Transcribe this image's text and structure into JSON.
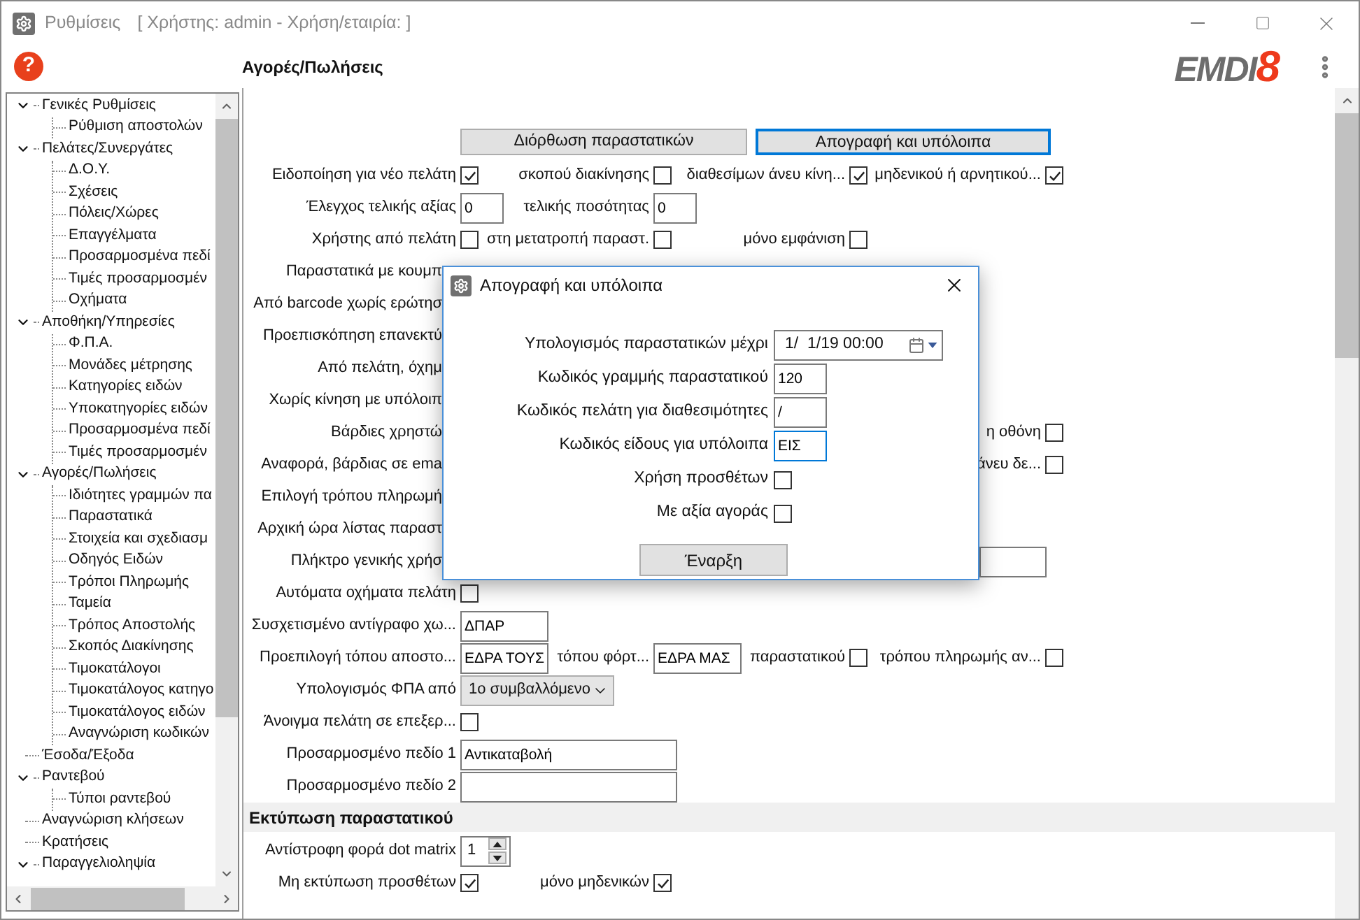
{
  "window": {
    "title": "Ρυθμίσεις",
    "context": "[ Χρήστης: admin - Χρήση/εταιρία: ]"
  },
  "header": {
    "help": "?",
    "title": "Αγορές/Πωλήσεις",
    "logo_text": "EMDI",
    "logo_mark": "8"
  },
  "sidebar": {
    "items": [
      {
        "label": "Γενικές Ρυθμίσεις",
        "expanded": true,
        "children": [
          {
            "label": "Ρύθμιση αποστολών"
          }
        ]
      },
      {
        "label": "Πελάτες/Συνεργάτες",
        "expanded": true,
        "children": [
          {
            "label": "Δ.Ο.Υ."
          },
          {
            "label": "Σχέσεις"
          },
          {
            "label": "Πόλεις/Χώρες"
          },
          {
            "label": "Επαγγέλματα"
          },
          {
            "label": "Προσαρμοσμένα πεδί"
          },
          {
            "label": "Τιμές προσαρμοσμέν"
          },
          {
            "label": "Οχήματα"
          }
        ]
      },
      {
        "label": "Αποθήκη/Υπηρεσίες",
        "expanded": true,
        "children": [
          {
            "label": "Φ.Π.Α."
          },
          {
            "label": "Μονάδες μέτρησης"
          },
          {
            "label": "Κατηγορίες ειδών"
          },
          {
            "label": "Υποκατηγορίες ειδών"
          },
          {
            "label": "Προσαρμοσμένα πεδί"
          },
          {
            "label": "Τιμές προσαρμοσμέν"
          }
        ]
      },
      {
        "label": "Αγορές/Πωλήσεις",
        "expanded": true,
        "children": [
          {
            "label": "Ιδιότητες γραμμών πα"
          },
          {
            "label": "Παραστατικά"
          },
          {
            "label": "Στοιχεία και σχεδιασμ"
          },
          {
            "label": "Οδηγός Ειδών"
          },
          {
            "label": "Τρόποι Πληρωμής"
          },
          {
            "label": "Ταμεία"
          },
          {
            "label": "Τρόπος Αποστολής"
          },
          {
            "label": "Σκοπός Διακίνησης"
          },
          {
            "label": "Τιμοκατάλογοι"
          },
          {
            "label": "Τιμοκατάλογος κατηγο"
          },
          {
            "label": "Τιμοκατάλογος ειδών"
          },
          {
            "label": "Αναγνώριση κωδικών"
          }
        ]
      },
      {
        "label": "Έσοδα/Έξοδα"
      },
      {
        "label": "Ραντεβού",
        "expanded": true,
        "children": [
          {
            "label": "Τύποι ραντεβού"
          }
        ]
      },
      {
        "label": "Αναγνώριση κλήσεων"
      },
      {
        "label": "Κρατήσεις"
      },
      {
        "label": "Παραγγελιοληψία",
        "expanded": true
      }
    ]
  },
  "tabs": [
    {
      "label": "Διόρθωση παραστατικών",
      "selected": false
    },
    {
      "label": "Απογραφή και υπόλοιπα",
      "selected": true
    }
  ],
  "rows": [
    {
      "fields": [
        {
          "kind": "checkbox",
          "label": "Ειδοποίηση για νέο πελάτη",
          "checked": true
        },
        {
          "kind": "checkbox",
          "label": "σκοπού διακίνησης",
          "checked": false
        },
        {
          "kind": "checkbox",
          "label": "διαθεσίμων άνευ κίνη...",
          "checked": true
        },
        {
          "kind": "checkbox",
          "label": "μηδενικού ή αρνητικού...",
          "checked": true
        }
      ]
    },
    {
      "fields": [
        {
          "kind": "text_short",
          "label": "Έλεγχος τελικής αξίας",
          "value": "0"
        },
        {
          "kind": "text_short",
          "label": "τελικής ποσότητας",
          "value": "0"
        }
      ]
    },
    {
      "fields": [
        {
          "kind": "checkbox",
          "label": "Χρήστης από πελάτη",
          "checked": false
        },
        {
          "kind": "checkbox",
          "label": "στη μετατροπή παραστ.",
          "checked": false
        },
        {
          "kind": "checkbox",
          "label": "μόνο εμφάνιση",
          "checked": false
        }
      ]
    },
    {
      "fields": [
        {
          "kind": "covered",
          "label": "Παραστατικά με κουμπ"
        }
      ]
    },
    {
      "fields": [
        {
          "kind": "covered",
          "label": "Από barcode χωρίς ερώτησ"
        }
      ]
    },
    {
      "fields": [
        {
          "kind": "covered",
          "label": "Προεπισκόπηση επανεκτύ"
        }
      ]
    },
    {
      "fields": [
        {
          "kind": "covered",
          "label": "Από πελάτη, όχημ"
        }
      ]
    },
    {
      "fields": [
        {
          "kind": "covered",
          "label": "Χωρίς κίνηση με υπόλοιπ"
        }
      ]
    },
    {
      "fields": [
        {
          "kind": "covered",
          "label": "Βάρδιες χρηστώ"
        }
      ],
      "right": {
        "kind": "checkbox",
        "label": "η οθόνη",
        "checked": false
      }
    },
    {
      "fields": [
        {
          "kind": "covered",
          "label": "Αναφορά, βάρδιας σε ema"
        }
      ],
      "right": {
        "kind": "checkbox",
        "label": "άνευ δε...",
        "checked": false
      }
    },
    {
      "fields": [
        {
          "kind": "covered",
          "label": "Επιλογή τρόπου πληρωμή"
        }
      ]
    },
    {
      "fields": [
        {
          "kind": "covered",
          "label": "Αρχική ώρα λίστας παραστ"
        }
      ]
    },
    {
      "fields": [
        {
          "kind": "covered",
          "label": "Πλήκτρο γενικής χρήσ"
        }
      ],
      "right": {
        "kind": "blank_field"
      }
    },
    {
      "fields": [
        {
          "kind": "checkbox",
          "label": "Αυτόματα οχήματα πελάτη",
          "checked": false
        }
      ]
    },
    {
      "fields": [
        {
          "kind": "text_medium",
          "label": "Συσχετισμένο αντίγραφο χω...",
          "value": "ΔΠΑΡ"
        }
      ]
    },
    {
      "fields": [
        {
          "kind": "text_medium",
          "label": "Προεπιλογή τόπου αποστο...",
          "value": "ΕΔΡΑ ΤΟΥΣ"
        },
        {
          "kind": "text_medium",
          "label": "τόπου φόρτ...",
          "value": "ΕΔΡΑ ΜΑΣ"
        },
        {
          "kind": "checkbox",
          "label": "παραστατικού",
          "checked": false
        },
        {
          "kind": "checkbox",
          "label": "τρόπου πληρωμής αν...",
          "checked": false
        }
      ]
    },
    {
      "fields": [
        {
          "kind": "select",
          "label": "Υπολογισμός ΦΠΑ από",
          "value": "1ο συμβαλλόμενο"
        }
      ]
    },
    {
      "fields": [
        {
          "kind": "checkbox",
          "label": "Άνοιγμα πελάτη σε επεξερ...",
          "checked": false
        }
      ]
    },
    {
      "fields": [
        {
          "kind": "text_wide",
          "label": "Προσαρμοσμένο πεδίο 1",
          "value": "Αντικαταβολή"
        }
      ]
    },
    {
      "fields": [
        {
          "kind": "text_wide",
          "label": "Προσαρμοσμένο πεδίο 2"
        }
      ]
    }
  ],
  "print_section": {
    "title": "Εκτύπωση παραστατικού",
    "rows": [
      {
        "fields": [
          {
            "kind": "spinner",
            "label": "Αντίστροφη φορά dot matrix",
            "value": "1"
          }
        ]
      },
      {
        "fields": [
          {
            "kind": "checkbox",
            "label": "Μη εκτύπωση προσθέτων",
            "checked": true
          },
          {
            "kind": "checkbox",
            "label": "μόνο μηδενικών",
            "checked": true
          }
        ]
      }
    ]
  },
  "dialog": {
    "title": "Απογραφή και υπόλοιπα",
    "fields": [
      {
        "kind": "datetime",
        "label": "Υπολογισμός παραστατικών μέχρι",
        "value": "1/  1/19 00:00"
      },
      {
        "kind": "text",
        "label": "Κωδικός γραμμής παραστατικού",
        "value": "120",
        "focused": false
      },
      {
        "kind": "text",
        "label": "Κωδικός πελάτη για διαθεσιμότητες",
        "value": "/",
        "focused": false
      },
      {
        "kind": "text",
        "label": "Κωδικός είδους για υπόλοιπα",
        "value": "ΕΙΣ",
        "focused": true
      },
      {
        "kind": "checkbox",
        "label": "Χρήση προσθέτων",
        "checked": false
      },
      {
        "kind": "checkbox",
        "label": "Με αξία αγοράς",
        "checked": false
      }
    ],
    "button": "Έναρξη"
  }
}
